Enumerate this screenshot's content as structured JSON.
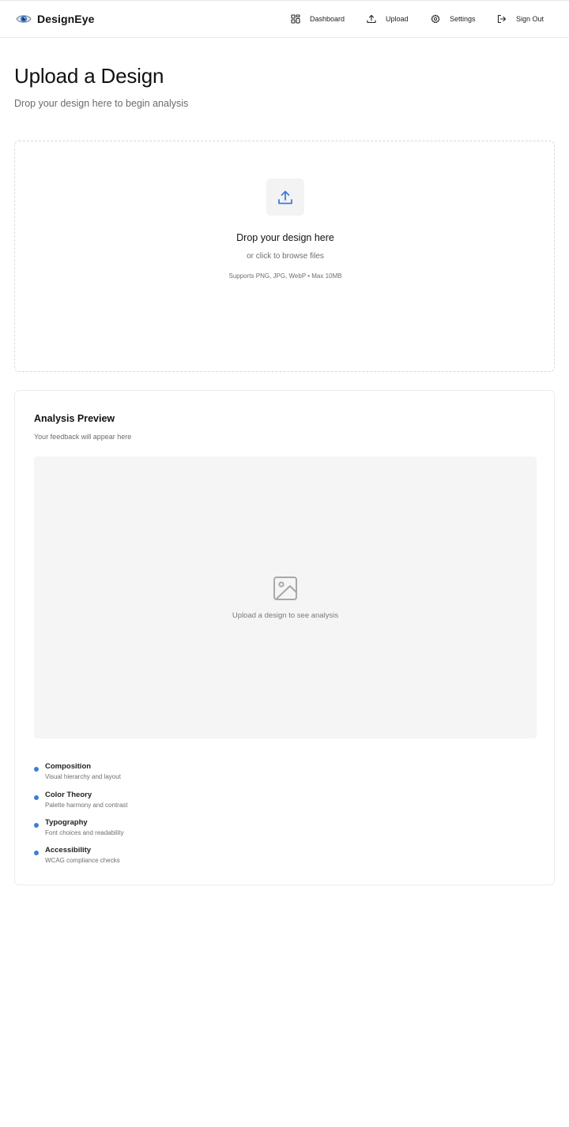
{
  "header": {
    "brand_name": "DesignEye",
    "brand_icon": "eye-icon",
    "nav": [
      {
        "label": "Dashboard",
        "icon": "dashboard-grid-icon"
      },
      {
        "label": "Upload",
        "icon": "upload-icon"
      },
      {
        "label": "Settings",
        "icon": "gear-icon"
      },
      {
        "label": "Sign Out",
        "icon": "sign-out-icon"
      }
    ]
  },
  "page": {
    "title": "Upload a Design",
    "subtitle": "Drop your design here to begin analysis"
  },
  "dropzone": {
    "icon": "upload-icon",
    "title": "Drop your design here",
    "subtitle": "or click to browse files",
    "support": "Supports PNG, JPG, WebP • Max 10MB"
  },
  "analysis": {
    "title": "Analysis Preview",
    "subtitle": "Your feedback will appear here",
    "placeholder_icon": "image-icon",
    "placeholder_text": "Upload a design to see analysis",
    "features": [
      {
        "title": "Composition",
        "desc": "Visual hierarchy and layout"
      },
      {
        "title": "Color Theory",
        "desc": "Palette harmony and contrast"
      },
      {
        "title": "Typography",
        "desc": "Font choices and readability"
      },
      {
        "title": "Accessibility",
        "desc": "WCAG compliance checks"
      }
    ]
  },
  "colors": {
    "accent": "#3b7dd8",
    "text_primary": "#111111",
    "text_muted": "#6b6b6b",
    "border": "#ececec",
    "panel_bg": "#f5f5f5"
  }
}
